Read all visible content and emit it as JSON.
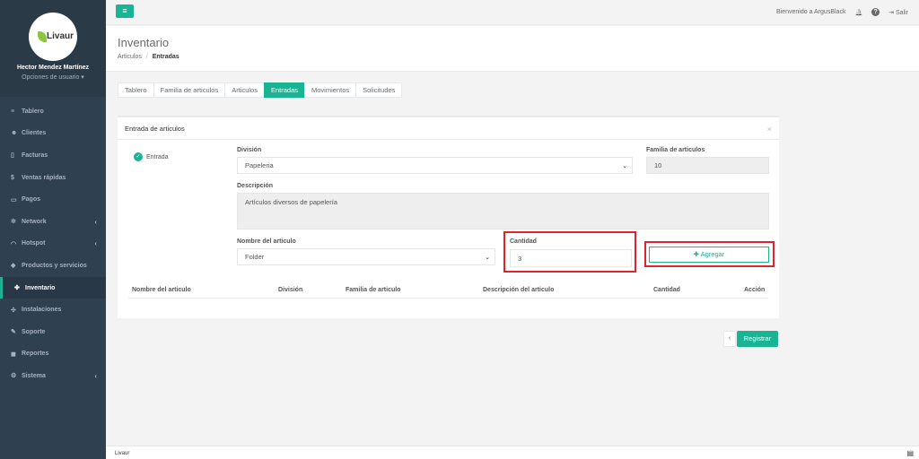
{
  "sidebar": {
    "logo_text": "Livaur",
    "user_name": "Hector Mendez Martínez",
    "user_options": "Opciones de usuario ▾",
    "items": [
      {
        "label": "Tablero",
        "icon": "≡"
      },
      {
        "label": "Clientes",
        "icon": "☻"
      },
      {
        "label": "Facturas",
        "icon": "▯"
      },
      {
        "label": "Ventas rápidas",
        "icon": "$"
      },
      {
        "label": "Pagos",
        "icon": "▭"
      },
      {
        "label": "Network",
        "icon": "✲"
      },
      {
        "label": "Hotspot",
        "icon": "◠"
      },
      {
        "label": "Productos y servicios",
        "icon": "◆"
      },
      {
        "label": "Inventario",
        "icon": "✤"
      },
      {
        "label": "Instalaciones",
        "icon": "✣"
      },
      {
        "label": "Soporte",
        "icon": "✎"
      },
      {
        "label": "Reportes",
        "icon": "◼"
      },
      {
        "label": "Sistema",
        "icon": "⚙"
      }
    ]
  },
  "topbar": {
    "menu_icon": "≡",
    "welcome": "Bienvenido a ArgusBlack",
    "bell_icon": "🔔",
    "help_icon": "?",
    "logout_icon": "⇥",
    "logout_label": "Salir"
  },
  "header": {
    "title": "Inventario",
    "breadcrumb_1": "Articulos",
    "breadcrumb_sep": "/",
    "breadcrumb_2": "Entradas"
  },
  "tabs": [
    "Tablero",
    "Familia de articulos",
    "Articulos",
    "Entradas",
    "Movimientos",
    "Solicitudes"
  ],
  "panel": {
    "title": "Entrada de articulos",
    "close": "×",
    "radio_label": "Entrada",
    "radio_check": "✓",
    "division_label": "División",
    "division_value": "Papeleria",
    "familia_label": "Familia de articulos",
    "familia_value": "10",
    "descripcion_label": "Descripción",
    "descripcion_value": "Artículos diversos de papelería",
    "nombre_label": "Nombre del articulo",
    "nombre_value": "Folder",
    "cantidad_label": "Cantidad",
    "cantidad_value": "3",
    "add_label": "✚ Agregar",
    "caret": "⌄"
  },
  "table": {
    "headers": [
      "Nombre del articulo",
      "División",
      "Familia de articulo",
      "Descripción del articulo",
      "Cantidad",
      "Acción"
    ]
  },
  "actions": {
    "prev": "‹",
    "register": "Registrar"
  },
  "footer": {
    "text": "Livaur",
    "icon": "▤"
  },
  "colors": {
    "accent": "#1ab394",
    "sidebar": "#2f4050",
    "highlight": "#e0232e"
  }
}
